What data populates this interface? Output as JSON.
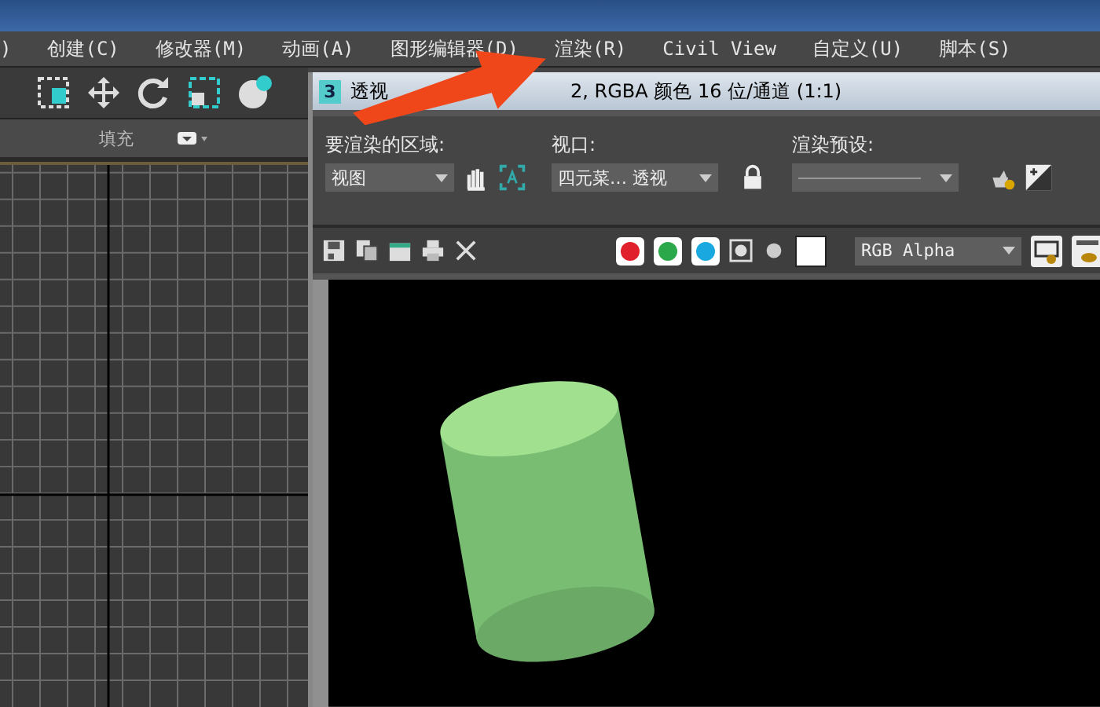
{
  "menu": [
    ")",
    "创建(C)",
    "修改器(M)",
    "动画(A)",
    "图形编辑器(D)",
    "渲染(R)",
    "Civil View",
    "自定义(U)",
    "脚本(S)"
  ],
  "left_panel": {
    "fill_label": "填充"
  },
  "render_window": {
    "app_icon_text": "3",
    "title_start": "透视",
    "title_end": "2, RGBA 颜色 16 位/通道 (1:1)",
    "area": {
      "label": "要渲染的区域:",
      "value": "视图"
    },
    "viewport": {
      "label": "视口:",
      "value": "四元菜… 透视"
    },
    "preset": {
      "label": "渲染预设:"
    },
    "channels": [
      {
        "color": "#e0202a",
        "on": true
      },
      {
        "color": "#2aa84a",
        "on": true
      },
      {
        "color": "#1aa8e0",
        "on": true
      }
    ],
    "display_mode": {
      "value": "RGB Alpha"
    }
  }
}
